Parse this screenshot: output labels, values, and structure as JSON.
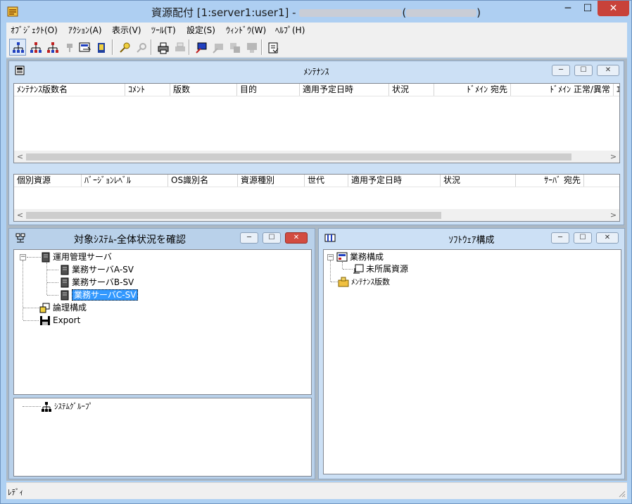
{
  "window": {
    "title": "資源配付 [1:server1:user1]",
    "title_sep": " - ",
    "title_host_blurred": "████-████-████",
    "title_ip_prefix": "(",
    "title_ip_blurred": "██.███.██.██",
    "title_ip_suffix": ")",
    "min_glyph": "─",
    "max_glyph": "☐",
    "close_glyph": "✕"
  },
  "menubar": [
    {
      "label": "ｵﾌﾞｼﾞｪｸﾄ(O)"
    },
    {
      "label": "ｱｸｼｮﾝ(A)"
    },
    {
      "label": "表示(V)"
    },
    {
      "label": "ﾂｰﾙ(T)"
    },
    {
      "label": "設定(S)"
    },
    {
      "label": "ｳｨﾝﾄﾞｳ(W)"
    },
    {
      "label": "ﾍﾙﾌﾟ(H)"
    }
  ],
  "toolbar": {
    "icons": [
      "tree-blue-icon",
      "tree-red-icon",
      "tree-red-alt-icon",
      "arrow-disabled-icon",
      "server-arrow-icon",
      "book-icon",
      "search-icon",
      "tool-disabled-icon",
      "printer-icon",
      "printer-disabled-icon",
      "monitor-icon",
      "monitor-disabled-icon",
      "pages-disabled-icon",
      "screen-disabled-icon",
      "export-icon"
    ]
  },
  "maintenance_window": {
    "title": "ﾒﾝﾃﾅﾝｽ",
    "top_columns": [
      "ﾒﾝﾃﾅﾝｽ版数名",
      "ｺﾒﾝﾄ",
      "版数",
      "目的",
      "適用予定日時",
      "状況",
      "ﾄﾞﾒｲﾝ 宛先",
      "ﾄﾞﾒｲﾝ 正常/異常",
      "ｴ"
    ],
    "bottom_columns": [
      "個別資源",
      "ﾊﾞｰｼﾞｮﾝﾚﾍﾞﾙ",
      "OS識別名",
      "資源種別",
      "世代",
      "適用予定日時",
      "状況",
      "ｻｰﾊﾞ 宛先",
      ""
    ],
    "scroll_left": "<",
    "scroll_right": ">"
  },
  "system_window": {
    "title": "対象ｼｽﾃﾑ-全体状況を確認",
    "tree": {
      "root": "運用管理サーバ",
      "servers": [
        "業務サーバA-SV",
        "業務サーバB-SV",
        "業務サーバC-SV"
      ],
      "logical": "論理構成",
      "export": "Export"
    },
    "lower_tree": {
      "group": "ｼｽﾃﾑｸﾞﾙｰﾌﾟ"
    }
  },
  "software_window": {
    "title": "ｿﾌﾄｳｪｱ構成",
    "tree": {
      "root": "業務構成",
      "child": "未所属資源",
      "maintenance": "ﾒﾝﾃﾅﾝｽ版数"
    }
  },
  "expander_symbol": "−",
  "status": {
    "text": "ﾚﾃﾞｨ"
  }
}
